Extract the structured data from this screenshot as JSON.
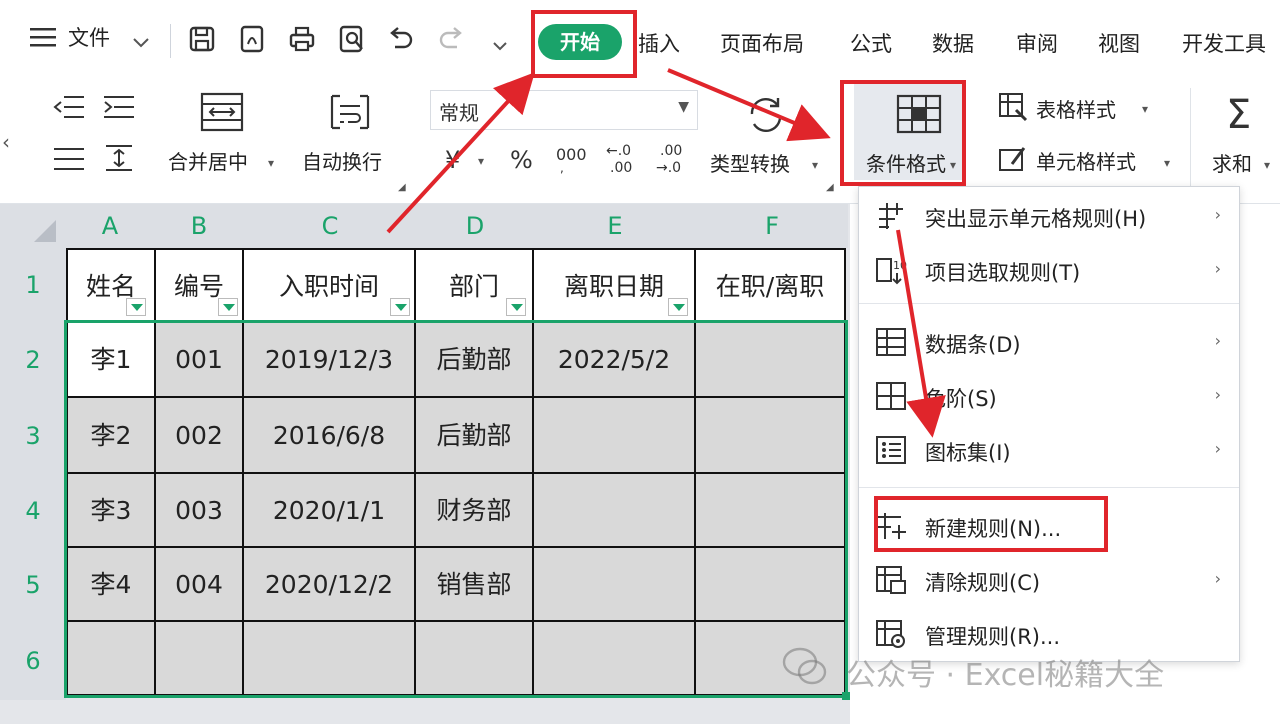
{
  "menu": {
    "file_label": "文件",
    "tabs": {
      "start": "开始",
      "insert": "插入",
      "page_layout": "页面布局",
      "formula": "公式",
      "data": "数据",
      "review": "审阅",
      "view": "视图",
      "developer": "开发工具"
    }
  },
  "ribbon": {
    "merge_center": "合并居中",
    "auto_wrap": "自动换行",
    "number_format": "常规",
    "type_convert": "类型转换",
    "conditional_format": "条件格式",
    "table_style": "表格样式",
    "cell_style": "单元格样式",
    "sum": "求和",
    "percent": "%",
    "thousands": "000"
  },
  "grid": {
    "columns": [
      "A",
      "B",
      "C",
      "D",
      "E",
      "F"
    ],
    "rows": [
      "1",
      "2",
      "3",
      "4",
      "5",
      "6"
    ],
    "header": [
      "姓名",
      "编号",
      "入职时间",
      "部门",
      "离职日期",
      "在职/离职"
    ],
    "data": [
      [
        "李1",
        "001",
        "2019/12/3",
        "后勤部",
        "2022/5/2",
        ""
      ],
      [
        "李2",
        "002",
        "2016/6/8",
        "后勤部",
        "",
        ""
      ],
      [
        "李3",
        "003",
        "2020/1/1",
        "财务部",
        "",
        ""
      ],
      [
        "李4",
        "004",
        "2020/12/2",
        "销售部",
        "",
        ""
      ],
      [
        "",
        "",
        "",
        "",
        "",
        ""
      ]
    ]
  },
  "dropdown": {
    "items": [
      {
        "label": "突出显示单元格规则(H)",
        "submenu": true
      },
      {
        "label": "项目选取规则(T)",
        "submenu": true
      },
      {
        "label": "数据条(D)",
        "submenu": true
      },
      {
        "label": "色阶(S)",
        "submenu": true
      },
      {
        "label": "图标集(I)",
        "submenu": true
      },
      {
        "label": "新建规则(N)...",
        "submenu": false
      },
      {
        "label": "清除规则(C)",
        "submenu": true
      },
      {
        "label": "管理规则(R)...",
        "submenu": false
      }
    ]
  },
  "watermark": "公众号 · Excel秘籍大全",
  "colors": {
    "accent": "#1aa36a",
    "annotation": "#e0252b",
    "data_fill": "#d9d9d9"
  }
}
